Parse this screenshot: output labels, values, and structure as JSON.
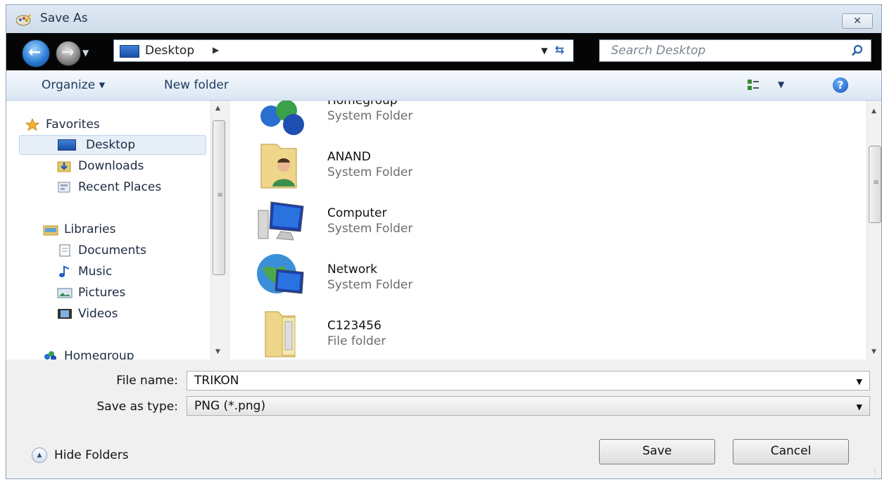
{
  "window": {
    "title": "Save As",
    "close_label": "✕"
  },
  "address_bar": {
    "location": "Desktop",
    "separator": "▶",
    "search_placeholder": "Search Desktop"
  },
  "toolbar": {
    "organize_label": "Organize ▾",
    "new_folder_label": "New folder",
    "help_label": "?"
  },
  "nav_pane": {
    "items": [
      {
        "label": "Favorites",
        "icon": "star-icon"
      },
      {
        "label": "Desktop",
        "icon": "desktop-icon",
        "selected": true
      },
      {
        "label": "Downloads",
        "icon": "downloads-icon"
      },
      {
        "label": "Recent Places",
        "icon": "recent-places-icon"
      },
      {
        "label": "Libraries",
        "icon": "libraries-icon"
      },
      {
        "label": "Documents",
        "icon": "documents-icon"
      },
      {
        "label": "Music",
        "icon": "music-icon"
      },
      {
        "label": "Pictures",
        "icon": "pictures-icon"
      },
      {
        "label": "Videos",
        "icon": "videos-icon"
      },
      {
        "label": "Homegroup",
        "icon": "homegroup-icon"
      }
    ]
  },
  "file_list": {
    "items": [
      {
        "name": "Homegroup",
        "type": "System Folder",
        "icon": "homegroup-icon"
      },
      {
        "name": "ANAND",
        "type": "System Folder",
        "icon": "user-folder-icon"
      },
      {
        "name": "Computer",
        "type": "System Folder",
        "icon": "computer-icon"
      },
      {
        "name": "Network",
        "type": "System Folder",
        "icon": "network-icon"
      },
      {
        "name": "C123456",
        "type": "File folder",
        "icon": "folder-icon"
      }
    ]
  },
  "form": {
    "file_name_label": "File name:",
    "file_name_value": "TRIKON",
    "save_type_label": "Save as type:",
    "save_type_value": "PNG (*.png)"
  },
  "footer": {
    "hide_folders_label": "Hide Folders",
    "save_label": "Save",
    "cancel_label": "Cancel"
  },
  "colors": {
    "title_bar": "#dfe9f5",
    "address_bar": "#050505",
    "selection": "#e6eef8"
  }
}
